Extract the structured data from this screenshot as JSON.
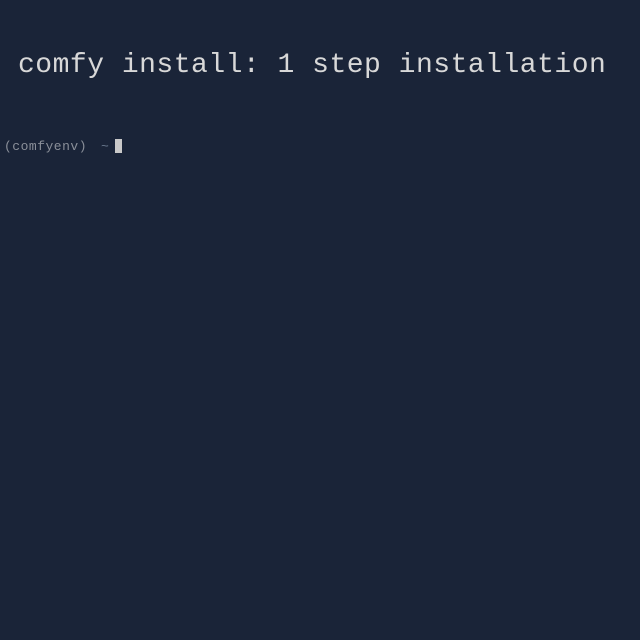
{
  "heading": "comfy install: 1 step installation",
  "terminal": {
    "env_name": "(comfyenv)",
    "prompt_symbol": "~"
  }
}
